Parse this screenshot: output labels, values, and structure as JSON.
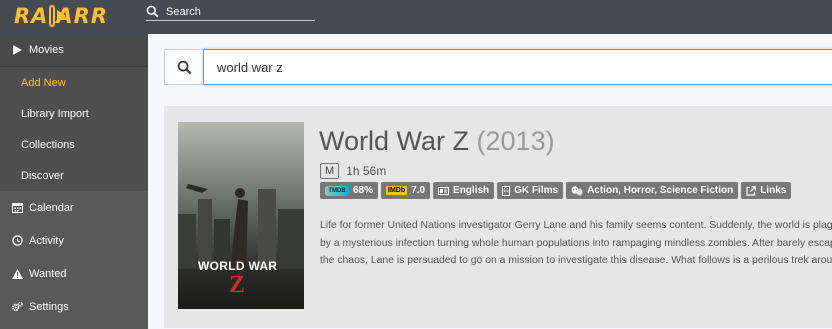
{
  "app": {
    "logo_text_left": "RA",
    "logo_text_right": "ARR",
    "brand_color": "#fdbe30"
  },
  "header": {
    "search_placeholder": "Search"
  },
  "sidebar": {
    "items": [
      {
        "label": "Movies",
        "icon": "play-icon"
      },
      {
        "label": "Calendar",
        "icon": "calendar-icon"
      },
      {
        "label": "Activity",
        "icon": "clock-icon"
      },
      {
        "label": "Wanted",
        "icon": "warning-icon"
      },
      {
        "label": "Settings",
        "icon": "cogs-icon"
      }
    ],
    "movies_sub": [
      {
        "label": "Add New",
        "active": true
      },
      {
        "label": "Library Import"
      },
      {
        "label": "Collections"
      },
      {
        "label": "Discover"
      }
    ]
  },
  "main": {
    "search_value": "world war z",
    "result": {
      "title": "World War Z",
      "year": "(2013)",
      "certification": "M",
      "runtime": "1h 56m",
      "poster_title": "WORLD WAR",
      "poster_z": "Z",
      "labels": {
        "tmdb": "68%",
        "imdb_logo": "IMDb",
        "tmdb_logo": "TMDB",
        "imdb": "7.0",
        "language": "English",
        "studio": "GK Films",
        "genres": "Action, Horror, Science Fiction",
        "links": "Links"
      },
      "overview": "Life for former United Nations investigator Gerry Lane and his family seems content. Suddenly, the world is plagued by a mysterious infection turning whole human populations into rampaging mindless zombies. After barely escaping the chaos, Lane is persuaded to go on a mission to investigate this disease. What follows is a perilous trek around the world where Lane must brave horrific dangers and long odds to find answers before civilization falls."
    }
  }
}
